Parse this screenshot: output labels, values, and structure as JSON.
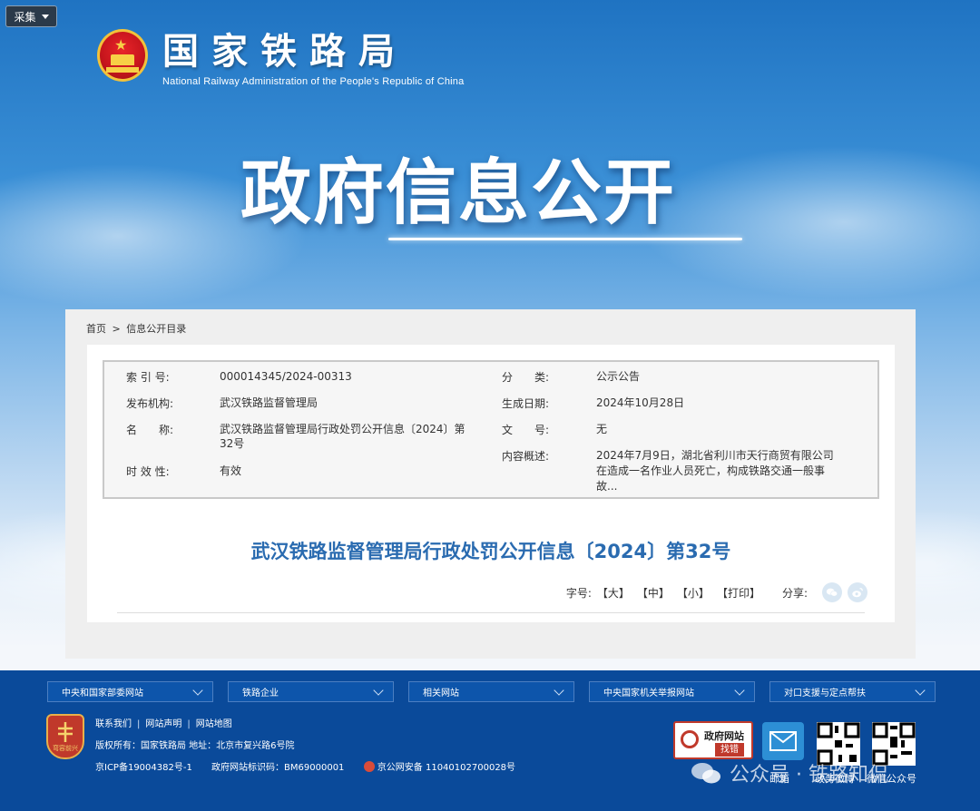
{
  "toolbar": {
    "collect_label": "采集"
  },
  "header": {
    "site_name_cn": "国家铁路局",
    "site_name_en": "National Railway Administration of the People's Republic of China",
    "hero_title": "政府信息公开"
  },
  "breadcrumb": {
    "home": "首页",
    "separator": ">",
    "current": "信息公开目录"
  },
  "meta": {
    "index_label": "索 引 号:",
    "index_value": "000014345/2024-00313",
    "category_label": "分　　类:",
    "category_value": "公示公告",
    "publisher_label": "发布机构:",
    "publisher_value": "武汉铁路监督管理局",
    "date_label": "生成日期:",
    "date_value": "2024年10月28日",
    "name_label": "名　　称:",
    "name_value_line1": "武汉铁路监督管理局行政处罚公开信息〔2024〕第",
    "name_value_line2": "32号",
    "doc_no_label": "文　　号:",
    "doc_no_value": "无",
    "summary_label": "内容概述:",
    "summary_line1": "2024年7月9日，湖北省利川市天行商贸有限公司",
    "summary_line2": "在造成一名作业人员死亡，构成铁路交通一般事",
    "summary_line3": "故...",
    "validity_label": "时 效 性:",
    "validity_value": "有效"
  },
  "document": {
    "title": "武汉铁路监督管理局行政处罚公开信息〔2024〕第32号",
    "font_size_label": "字号:",
    "size_large": "【大】",
    "size_medium": "【中】",
    "size_small": "【小】",
    "print": "【打印】",
    "share_label": "分享:"
  },
  "footer": {
    "selects": [
      "中央和国家部委网站",
      "铁路企业",
      "相关网站",
      "中央国家机关举报网站",
      "对口支援与定点帮扶"
    ],
    "badge_text": "弯容前兴",
    "links": [
      "联系我们",
      "网站声明",
      "网站地图"
    ],
    "copyright": "版权所有：国家铁路局  地址：北京市复兴路6号院",
    "icp": "京ICP备19004382号-1",
    "site_id": "政府网站标识码：BM69000001",
    "police": "京公网安备 11040102700028号",
    "gov_badge_line1": "政府网站",
    "gov_badge_line2": "找错",
    "caption_mail": "邮箱",
    "caption_weibo": "政务微博",
    "caption_wechat": "微信公众号"
  },
  "watermark": {
    "text": "公众号 · 铁路知侃"
  },
  "colors": {
    "title_blue": "#2a6bb0",
    "footer_blue": "#0a4a9a",
    "brand_red": "#c0392b"
  }
}
